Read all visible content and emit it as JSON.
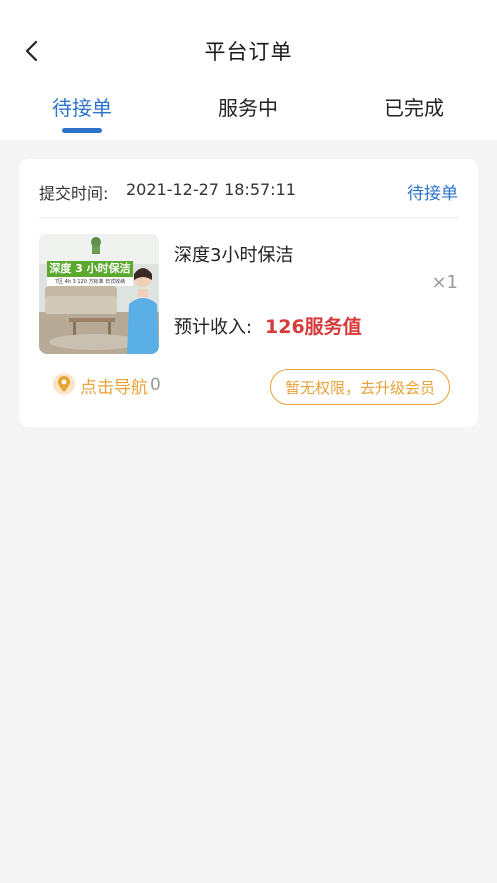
{
  "header": {
    "title": "平台订单",
    "back_icon": "chevron-left-icon"
  },
  "tabs": [
    {
      "label": "待接单",
      "active": true
    },
    {
      "label": "服务中",
      "active": false
    },
    {
      "label": "已完成",
      "active": false
    }
  ],
  "order": {
    "time_label": "提交时间:",
    "time_value": "2021-12-27 18:57:11",
    "status": "待接单",
    "product_name": "深度3小时保洁",
    "quantity": "×1",
    "income_label": "预计收入:",
    "income_value": "126服务值",
    "thumbnail": {
      "banner_text": "深度 3 小时保洁",
      "sub_text": "7区 4h 3 120 方标准 日式收纳"
    },
    "nav_label": "点击导航",
    "nav_count": "0",
    "nav_icon": "location-pin-icon",
    "upgrade_label": "暂无权限，去升级会员"
  },
  "colors": {
    "accent_blue": "#2e74c9",
    "price_red": "#d83a3a",
    "accent_orange": "#e8a236",
    "background": "#f5f5f5"
  }
}
